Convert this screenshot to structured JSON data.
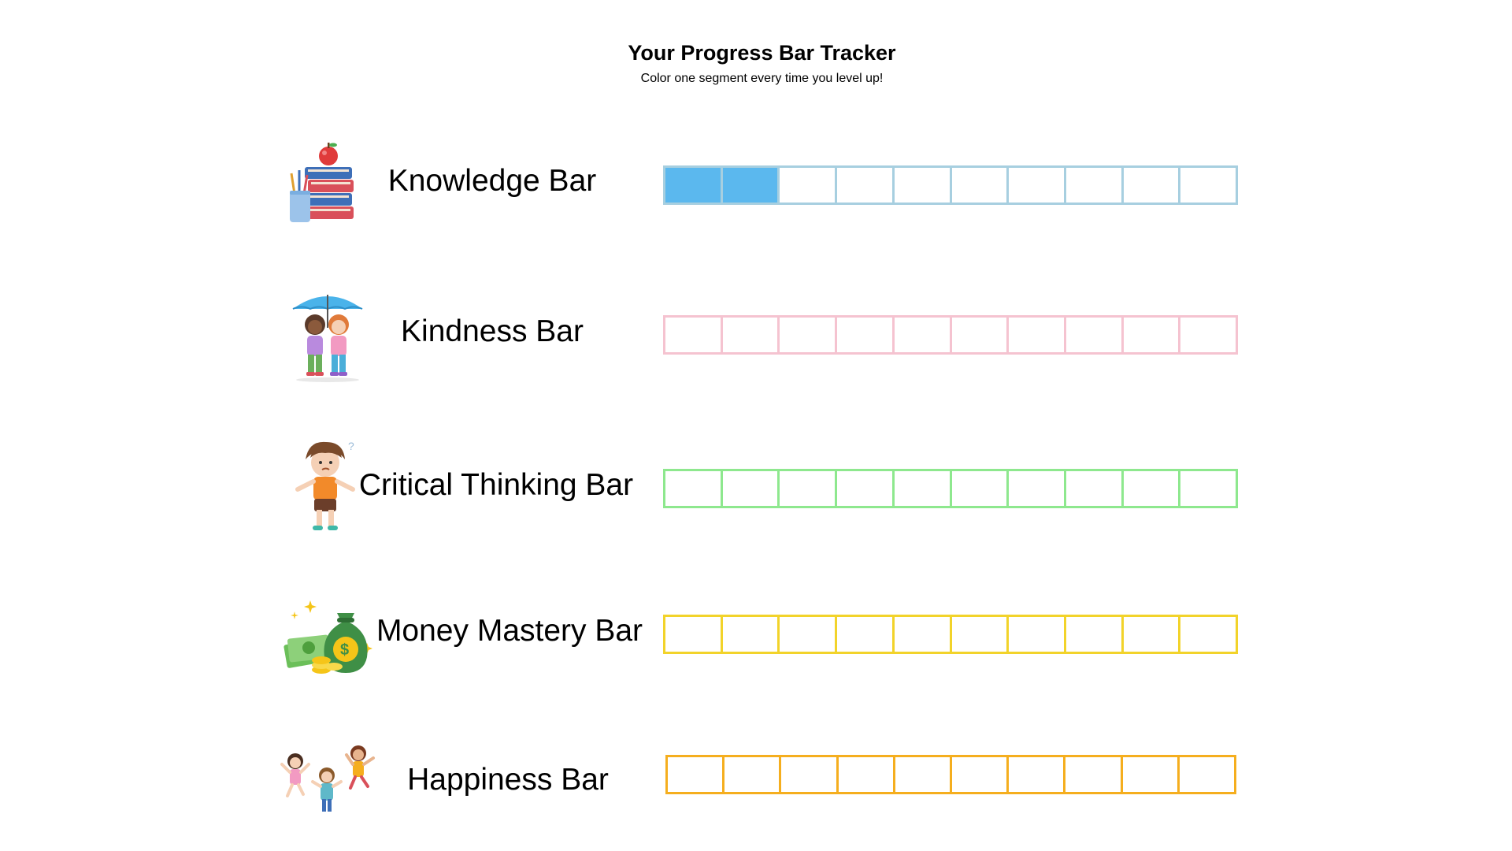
{
  "header": {
    "title": "Your Progress Bar Tracker",
    "subtitle": "Color one segment every time you level up!"
  },
  "bars": [
    {
      "label": "Knowledge Bar",
      "icon": "books-apple-pencils-icon",
      "color": "#A7CFE0",
      "fill_color": "#5BB8EE",
      "filled": 2,
      "segments": 10
    },
    {
      "label": "Kindness Bar",
      "icon": "kids-under-umbrella-icon",
      "color": "#F5C3D0",
      "fill_color": "#F5C3D0",
      "filled": 0,
      "segments": 10
    },
    {
      "label": "Critical Thinking Bar",
      "icon": "thinking-boy-icon",
      "color": "#8EE88E",
      "fill_color": "#8EE88E",
      "filled": 0,
      "segments": 10
    },
    {
      "label": "Money Mastery Bar",
      "icon": "money-bag-coins-icon",
      "color": "#F2D32A",
      "fill_color": "#F2D32A",
      "filled": 0,
      "segments": 10
    },
    {
      "label": "Happiness Bar",
      "icon": "jumping-kids-icon",
      "color": "#F5AE1E",
      "fill_color": "#F5AE1E",
      "filled": 0,
      "segments": 10
    }
  ]
}
